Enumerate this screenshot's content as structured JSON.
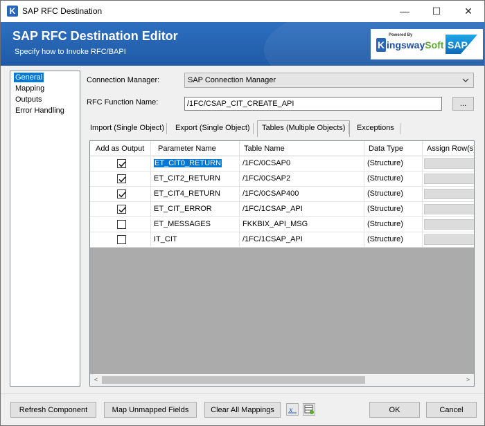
{
  "window": {
    "title": "SAP RFC Destination",
    "app_icon_letter": "K",
    "minimize_glyph": "—",
    "maximize_glyph": "☐",
    "close_glyph": "✕"
  },
  "banner": {
    "heading": "SAP RFC Destination Editor",
    "subheading": "Specify how to Invoke RFC/BAPI",
    "logo_powered_by": "Powered By",
    "logo_brand_a": "ingsway",
    "logo_brand_b": "Soft",
    "logo_k": "K",
    "sap_logo_text": "SAP"
  },
  "nav": {
    "items": [
      {
        "label": "General",
        "selected": true
      },
      {
        "label": "Mapping",
        "selected": false
      },
      {
        "label": "Outputs",
        "selected": false
      },
      {
        "label": "Error Handling",
        "selected": false
      }
    ]
  },
  "form": {
    "connection_manager_label": "Connection Manager:",
    "connection_manager_value": "SAP Connection Manager",
    "rfc_function_label": "RFC Function Name:",
    "rfc_function_value": "/1FC/CSAP_CIT_CREATE_API",
    "browse_label": "..."
  },
  "tabs": [
    {
      "label": "Import (Single Object)",
      "active": false
    },
    {
      "label": "Export (Single Object)",
      "active": false
    },
    {
      "label": "Tables (Multiple Objects)",
      "active": true
    },
    {
      "label": "Exceptions",
      "active": false
    }
  ],
  "grid": {
    "columns": [
      "Add as Output",
      "Parameter Name",
      "Table Name",
      "Data Type",
      "Assign Row(s)"
    ],
    "rows": [
      {
        "checked": true,
        "parameter": "ET_CIT0_RETURN",
        "table": "/1FC/0CSAP0",
        "type": "(Structure)",
        "selected": true
      },
      {
        "checked": true,
        "parameter": "ET_CIT2_RETURN",
        "table": "/1FC/0CSAP2",
        "type": "(Structure)",
        "selected": false
      },
      {
        "checked": true,
        "parameter": "ET_CIT4_RETURN",
        "table": "/1FC/0CSAP400",
        "type": "(Structure)",
        "selected": false
      },
      {
        "checked": true,
        "parameter": "ET_CIT_ERROR",
        "table": "/1FC/1CSAP_API",
        "type": "(Structure)",
        "selected": false
      },
      {
        "checked": false,
        "parameter": "ET_MESSAGES",
        "table": "FKKBIX_API_MSG",
        "type": "(Structure)",
        "selected": false
      },
      {
        "checked": false,
        "parameter": "IT_CIT",
        "table": "/1FC/1CSAP_API",
        "type": "(Structure)",
        "selected": false
      }
    ],
    "scroll_left_glyph": "<",
    "scroll_right_glyph": ">"
  },
  "buttons": {
    "refresh": "Refresh Component",
    "map_unmapped": "Map Unmapped Fields",
    "clear_mappings": "Clear All Mappings",
    "ok": "OK",
    "cancel": "Cancel"
  },
  "colors": {
    "banner": "#1f5aa6",
    "selection": "#0078d7"
  }
}
